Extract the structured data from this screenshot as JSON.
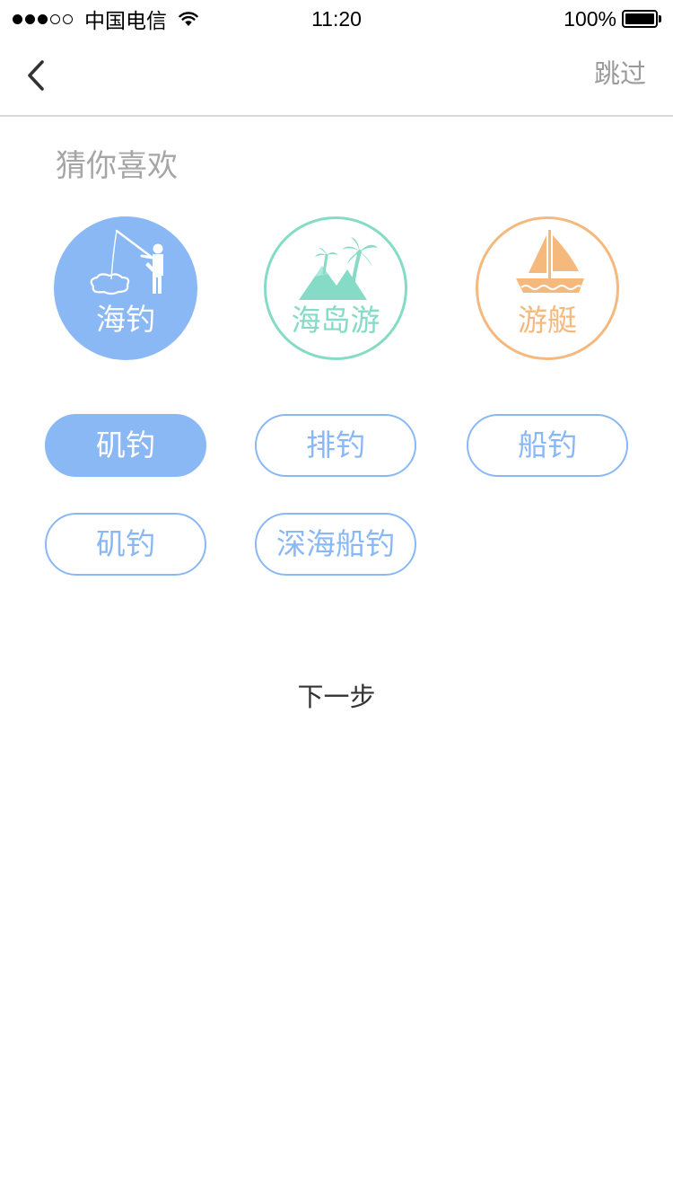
{
  "status_bar": {
    "carrier": "中国电信",
    "time": "11:20",
    "battery": "100%",
    "signal_bars_filled": 3,
    "signal_bars_total": 5
  },
  "nav": {
    "back_icon": "chevron-left-icon",
    "skip_label": "跳过"
  },
  "section_title": "猜你喜欢",
  "categories": [
    {
      "label": "海钓",
      "icon": "fishing-person-icon",
      "color": "#89b8f4",
      "selected": true
    },
    {
      "label": "海岛游",
      "icon": "palm-island-icon",
      "color": "#85dbc6",
      "selected": false
    },
    {
      "label": "游艇",
      "icon": "sailboat-icon",
      "color": "#f5b97e",
      "selected": false
    }
  ],
  "tags": [
    {
      "label": "矶钓",
      "selected": true
    },
    {
      "label": "排钓",
      "selected": false
    },
    {
      "label": "船钓",
      "selected": false
    },
    {
      "label": "矶钓",
      "selected": false
    },
    {
      "label": "深海船钓",
      "selected": false
    }
  ],
  "next_label": "下一步",
  "colors": {
    "accent_blue": "#89b8f4",
    "accent_green": "#85dbc6",
    "accent_orange": "#f5b97e",
    "muted_text": "#a6a6a6"
  }
}
